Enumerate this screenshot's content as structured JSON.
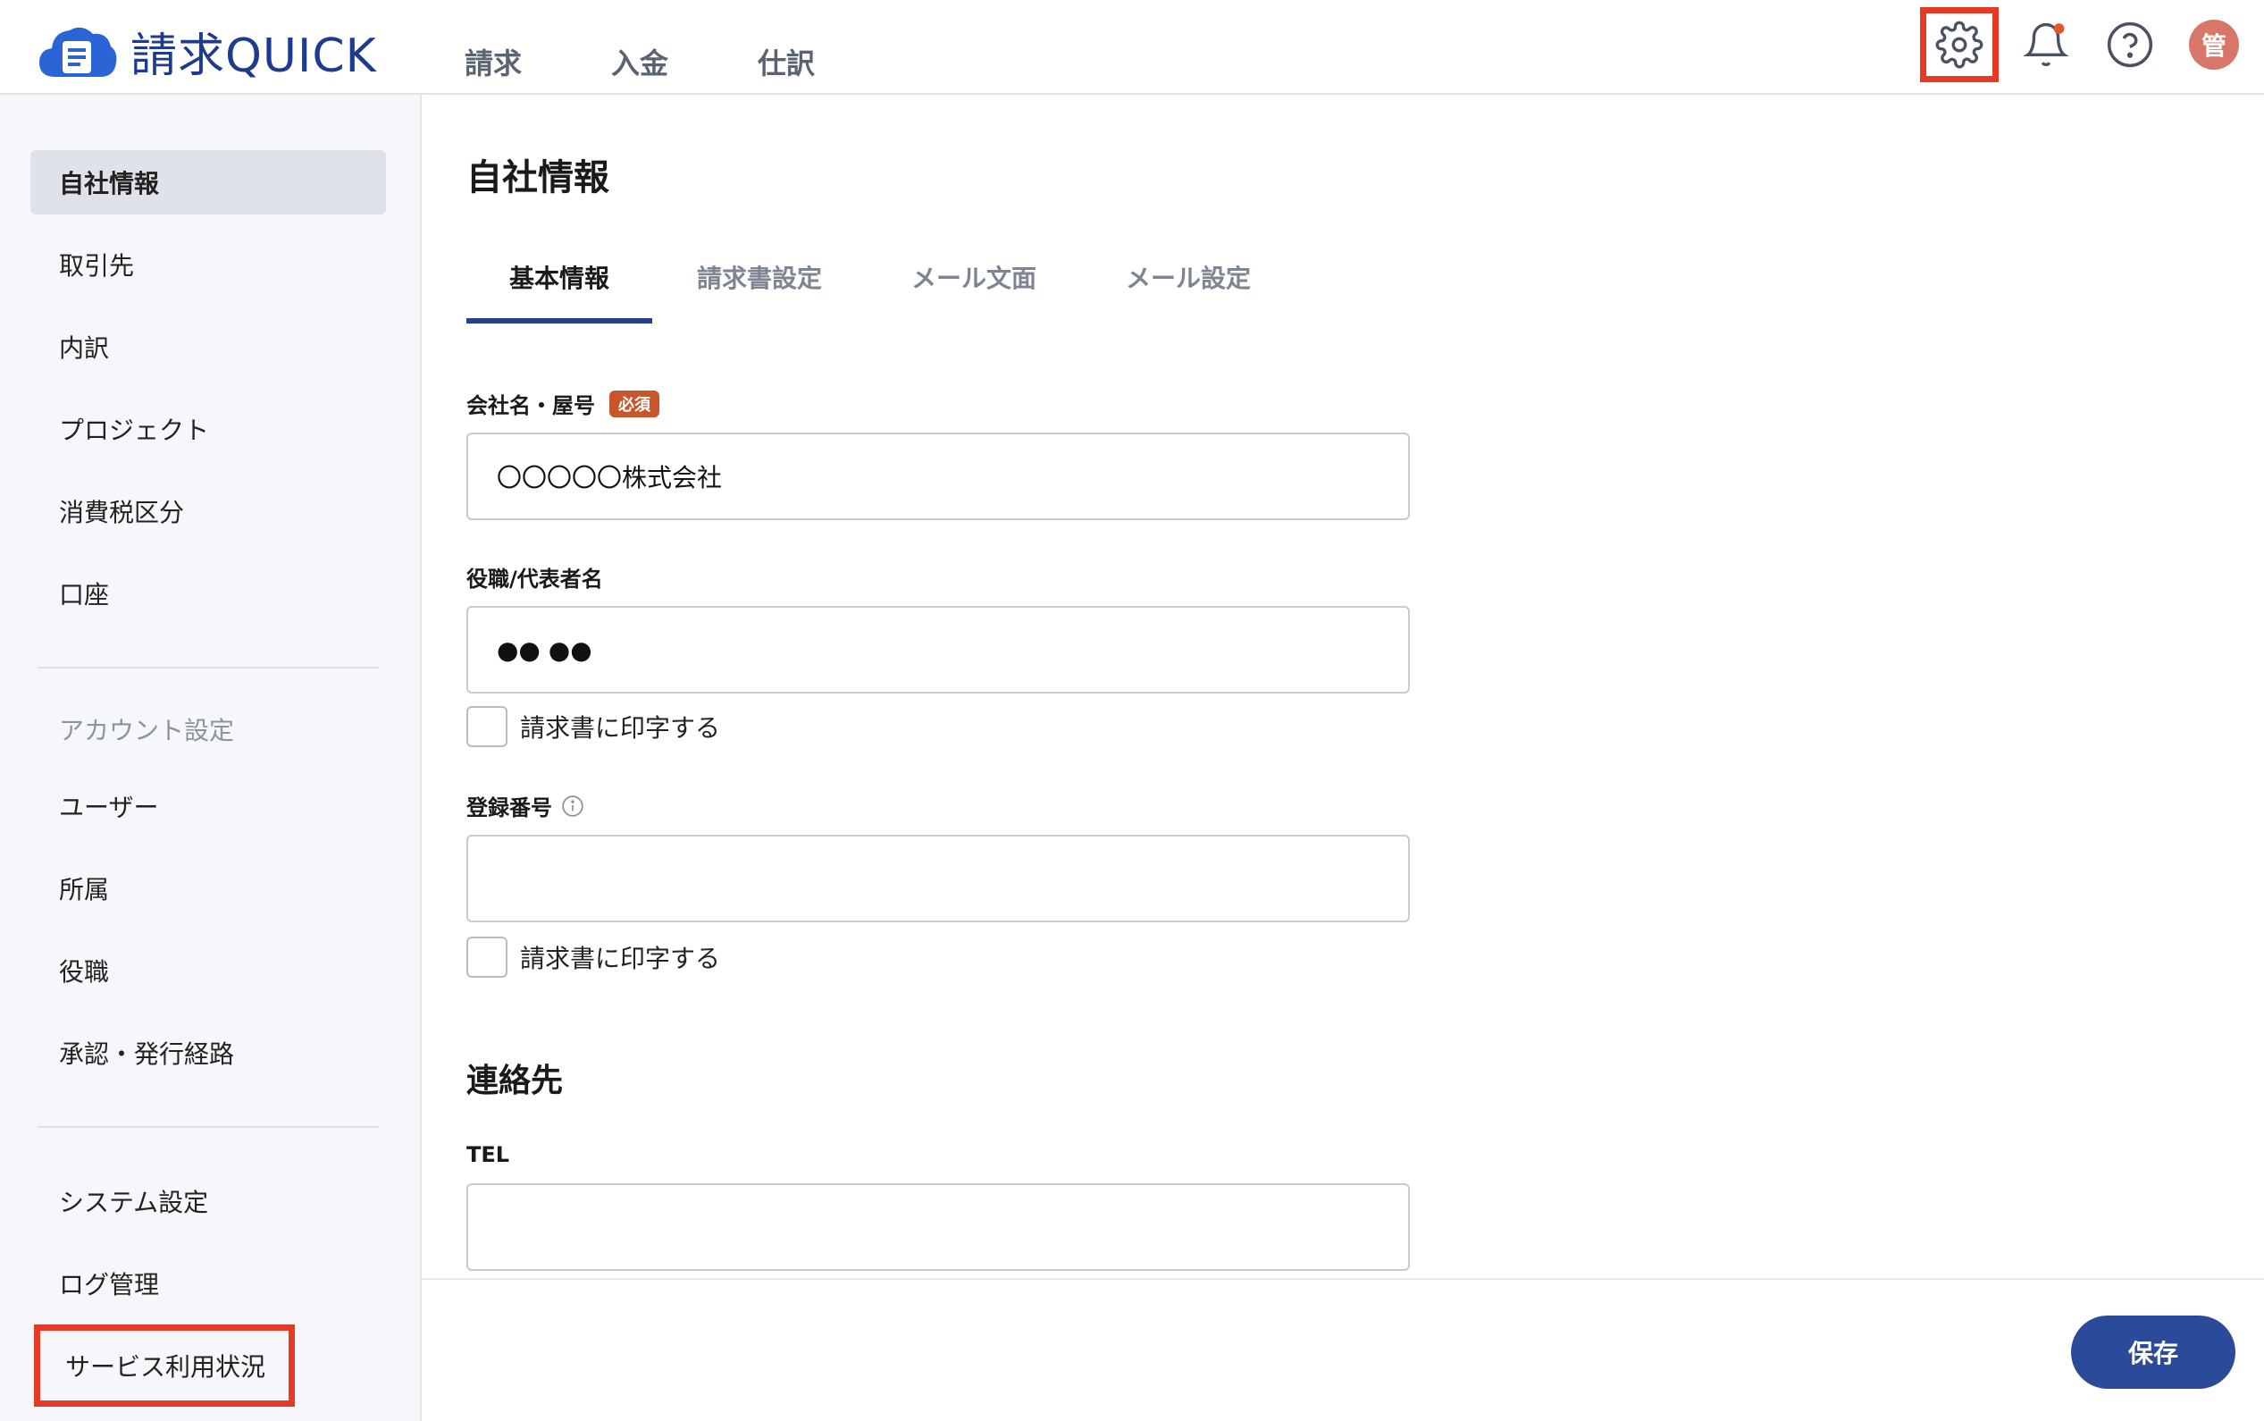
{
  "app": {
    "logo_text": "請求QUICK",
    "nav": [
      "請求",
      "入金",
      "仕訳"
    ],
    "icons": [
      "gear-icon",
      "bell-icon",
      "help-icon"
    ],
    "avatar_initial": "管",
    "notification_dot_color": "#e4572e"
  },
  "sidebar": {
    "group1": [
      "自社情報",
      "取引先",
      "内訳",
      "プロジェクト",
      "消費税区分",
      "口座"
    ],
    "account_heading": "アカウント設定",
    "group2": [
      "ユーザー",
      "所属",
      "役職",
      "承認・発行経路"
    ],
    "group3": [
      "システム設定",
      "ログ管理",
      "サービス利用状況"
    ]
  },
  "main": {
    "title": "自社情報",
    "tabs": [
      "基本情報",
      "請求書設定",
      "メール文面",
      "メール設定"
    ],
    "company_label": "会社名・屋号",
    "required_badge": "必須",
    "company_value": "〇〇〇〇〇株式会社",
    "rep_label": "役職/代表者名",
    "rep_value": "●● ●●",
    "print_label": "請求書に印字する",
    "regno_label": "登録番号",
    "regno_value": "",
    "contact_title": "連絡先",
    "tel_label": "TEL",
    "tel_value": "",
    "save_label": "保存"
  },
  "colors": {
    "accent": "#27418f",
    "highlight_box": "#e53a26",
    "required_badge": "#c9562a"
  }
}
